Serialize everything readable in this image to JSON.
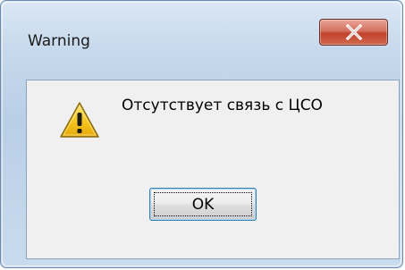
{
  "window": {
    "title": "Warning"
  },
  "titlebar": {
    "close_icon": "close-icon"
  },
  "dialog": {
    "icon": "warning-icon",
    "message": "Отсутствует связь с ЦСО",
    "ok_label": "OK"
  },
  "colors": {
    "close_button": "#c1412c",
    "content_bg": "#f0f0f0",
    "warning_yellow": "#f3c21a"
  }
}
